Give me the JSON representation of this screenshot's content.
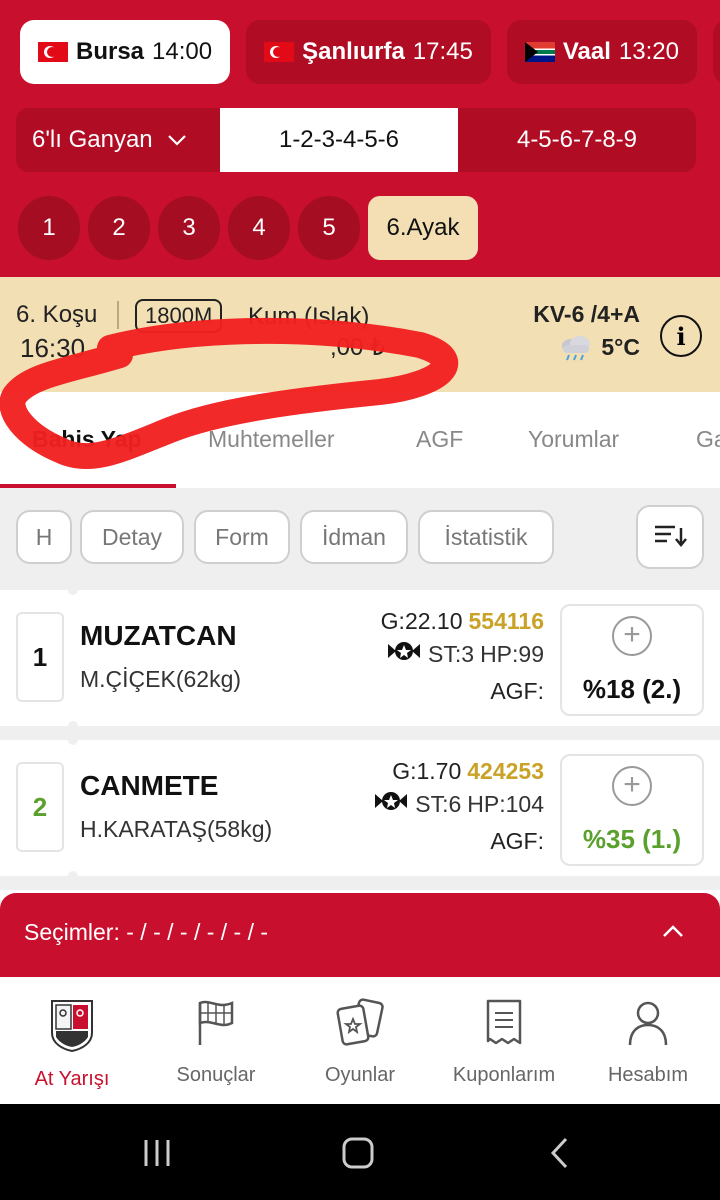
{
  "city_tabs": [
    {
      "name": "Bursa",
      "time": "14:00",
      "flag": "tr",
      "active": true
    },
    {
      "name": "Şanlıurfa",
      "time": "17:45",
      "flag": "tr",
      "active": false
    },
    {
      "name": "Vaal",
      "time": "13:20",
      "flag": "za",
      "active": false
    }
  ],
  "bet": {
    "type_label": "6'lı Ganyan",
    "segments": [
      "1-2-3-4-5-6",
      "4-5-6-7-8-9"
    ]
  },
  "legs": [
    "1",
    "2",
    "3",
    "4",
    "5",
    "6.Ayak"
  ],
  "race_info": {
    "run": "6. Koşu",
    "distance": "1800M",
    "surface": "Kum (Islak)",
    "time": "16:30",
    "prize_fragment": ",00 ₺",
    "conditions": "KV-6 /4+A",
    "temperature": "5°C"
  },
  "tabs": [
    "Bahis Yap",
    "Muhtemeller",
    "AGF",
    "Yorumlar",
    "Ga"
  ],
  "filters": [
    "H",
    "Detay",
    "Form",
    "İdman",
    "İstatistik"
  ],
  "horses": [
    {
      "no": "1",
      "name": "MUZATCAN",
      "jockey": "M.ÇİÇEK(62kg)",
      "g": "G:22.10",
      "odds_code": "554116",
      "st": "ST:3",
      "hp": "HP:99",
      "agf_label": "AGF:",
      "agf": "%18 (2.)"
    },
    {
      "no": "2",
      "name": "CANMETE",
      "jockey": "H.KARATAŞ(58kg)",
      "g": "G:1.70",
      "odds_code": "424253",
      "st": "ST:6",
      "hp": "HP:104",
      "agf_label": "AGF:",
      "agf": "%35 (1.)"
    }
  ],
  "selections": {
    "label": "Seçimler: - / - / - / - / - / -"
  },
  "bottom_nav": [
    "At Yarışı",
    "Sonuçlar",
    "Oyunlar",
    "Kuponlarım",
    "Hesabım"
  ],
  "colors": {
    "brand_red": "#c8102e",
    "tab_bg": "#f2dfb3",
    "agf_first": "#5aa02c",
    "odds_gold": "#c9a227"
  }
}
